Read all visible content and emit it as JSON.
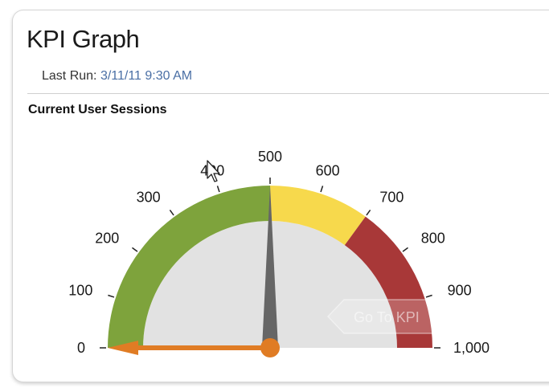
{
  "widget": {
    "title": "KPI Graph",
    "last_run_label": "Last Run:",
    "last_run_value": "3/11/11 9:30 AM",
    "subtitle": "Current User Sessions"
  },
  "gauge": {
    "min": 0,
    "max": 1000,
    "value": 500,
    "target_value": 0,
    "ticks": [
      0,
      100,
      200,
      300,
      400,
      500,
      600,
      700,
      800,
      900,
      1000
    ],
    "tick_labels": [
      "0",
      "100",
      "200",
      "300",
      "400",
      "500",
      "600",
      "700",
      "800",
      "900",
      "1,000"
    ],
    "bands": [
      {
        "from": 0,
        "to": 500,
        "color": "#7ea33c"
      },
      {
        "from": 500,
        "to": 700,
        "color": "#f7d94c"
      },
      {
        "from": 700,
        "to": 1000,
        "color": "#a83838"
      }
    ],
    "colors": {
      "face": "#e2e2e2",
      "needle": "#666666",
      "target_marker": "#e07c24"
    }
  },
  "overlay": {
    "button_label": "Go To KPI",
    "icon": "mouse-cursor-icon"
  }
}
